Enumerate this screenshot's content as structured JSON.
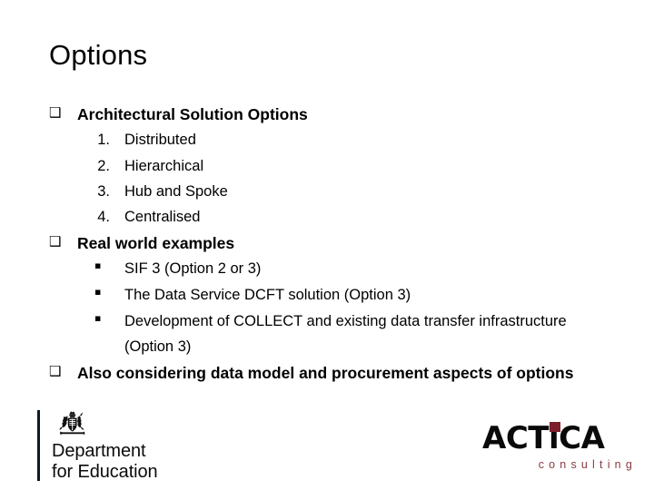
{
  "slide": {
    "title": "Options",
    "bullet_square_glyph": "❑",
    "sub_square_glyph": "▪",
    "groups": [
      {
        "heading": "Architectural Solution Options",
        "list_type": "numbered",
        "items": [
          {
            "number": "1.",
            "text": "Distributed"
          },
          {
            "number": "2.",
            "text": "Hierarchical"
          },
          {
            "number": "3.",
            "text": "Hub and Spoke"
          },
          {
            "number": "4.",
            "text": "Centralised"
          }
        ]
      },
      {
        "heading": "Real world examples",
        "list_type": "bulleted",
        "items": [
          {
            "text": "SIF 3 (Option 2 or 3)"
          },
          {
            "text": "The Data Service DCFT solution (Option 3)"
          },
          {
            "text": "Development of COLLECT and existing data transfer infrastructure (Option 3)"
          }
        ]
      },
      {
        "heading": "Also considering data model and procurement aspects of options",
        "list_type": "none",
        "items": []
      }
    ]
  },
  "footer": {
    "dfe_logo": {
      "crest_label": "royal-coat-of-arms",
      "name": "Department\nfor Education",
      "rule_color": "#0b1b2b"
    },
    "actica_logo": {
      "wordmark": "ACTiCA",
      "tagline": "consulting",
      "accent_color": "#7d1f2b",
      "tagline_color": "#8a3a42"
    }
  }
}
